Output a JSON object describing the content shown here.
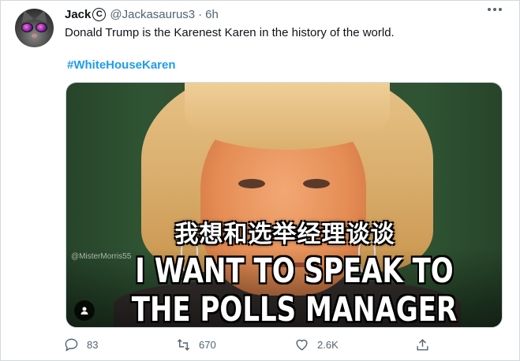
{
  "tweet": {
    "author_name": "Jack",
    "author_badge": "C",
    "handle": "@Jackasaurus3",
    "separator": "·",
    "time": "6h",
    "text": "Donald Trump is the Karenest Karen in the history of the world.",
    "hashtag": "#WhiteHouseKaren"
  },
  "media": {
    "overlay_chinese": "我想和选举经理谈谈",
    "meme_line_1": "I WANT TO SPEAK TO",
    "meme_line_2": "THE POLLS MANAGER",
    "watermark": "@MisterMorris55",
    "user_tag_icon": "person-icon"
  },
  "actions": {
    "reply_count": "83",
    "retweet_count": "670",
    "like_count": "2.6K",
    "reply_icon": "speech-bubble-icon",
    "retweet_icon": "retweet-arrows-icon",
    "like_icon": "heart-icon",
    "share_icon": "share-upload-icon"
  },
  "colors": {
    "link": "#1d9bf0",
    "muted": "#536471",
    "text": "#0f1419",
    "border": "#cfd9de"
  }
}
